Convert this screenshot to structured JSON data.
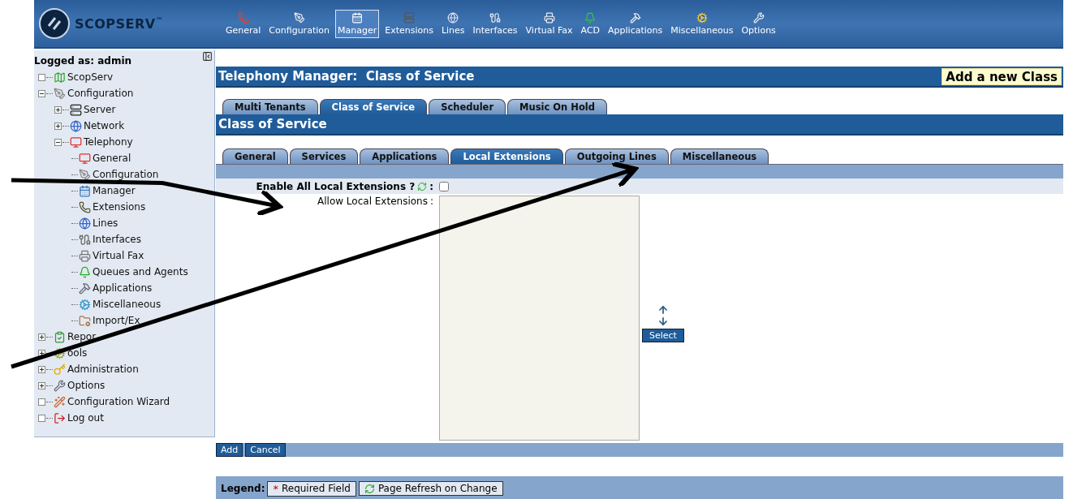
{
  "header": {
    "logo": "SCOPSERV",
    "logo_mark": "™"
  },
  "toolbar": [
    {
      "label": "General",
      "selected": false
    },
    {
      "label": "Configuration",
      "selected": false
    },
    {
      "label": "Manager",
      "selected": true
    },
    {
      "label": "Extensions",
      "selected": false
    },
    {
      "label": "Lines",
      "selected": false
    },
    {
      "label": "Interfaces",
      "selected": false
    },
    {
      "label": "Virtual Fax",
      "selected": false
    },
    {
      "label": "ACD",
      "selected": false
    },
    {
      "label": "Applications",
      "selected": false
    },
    {
      "label": "Miscellaneous",
      "selected": false
    },
    {
      "label": "Options",
      "selected": false
    }
  ],
  "sidebar": {
    "user_label": "Logged as: admin",
    "tree": [
      {
        "label": "ScopServ"
      },
      {
        "label": "Configuration",
        "expanded": true,
        "children": [
          {
            "label": "Server",
            "expanded": false
          },
          {
            "label": "Network",
            "expanded": false
          },
          {
            "label": "Telephony",
            "expanded": true,
            "children": [
              {
                "label": "General"
              },
              {
                "label": "Configuration"
              },
              {
                "label": "Manager"
              },
              {
                "label": "Extensions"
              },
              {
                "label": "Lines"
              },
              {
                "label": "Interfaces"
              },
              {
                "label": "Virtual Fax"
              },
              {
                "label": "Queues and Agents"
              },
              {
                "label": "Applications"
              },
              {
                "label": "Miscellaneous"
              },
              {
                "label": "Import/Ex"
              }
            ]
          }
        ]
      },
      {
        "label": "Repor",
        "expanded": false
      },
      {
        "label": "ools",
        "expanded": false
      },
      {
        "label": "Administration",
        "expanded": false
      },
      {
        "label": "Options",
        "expanded": false
      },
      {
        "label": "Configuration Wizard"
      },
      {
        "label": "Log out"
      }
    ]
  },
  "main": {
    "title": "Telephony Manager:  Class of Service",
    "add_button": "Add a new Class",
    "tabs": [
      {
        "label": "Multi Tenants",
        "selected": false
      },
      {
        "label": "Class of Service",
        "selected": true
      },
      {
        "label": "Scheduler",
        "selected": false
      },
      {
        "label": "Music On Hold",
        "selected": false
      }
    ],
    "section_title": "Class of Service",
    "subtabs": [
      {
        "label": "General",
        "selected": false
      },
      {
        "label": "Services",
        "selected": false
      },
      {
        "label": "Applications",
        "selected": false
      },
      {
        "label": "Local Extensions",
        "selected": true
      },
      {
        "label": "Outgoing Lines",
        "selected": false
      },
      {
        "label": "Miscellaneous",
        "selected": false
      }
    ],
    "form": {
      "enable_label": "Enable All Local Extensions ?",
      "enable_colon": ":",
      "enable_checked": false,
      "allow_label": "Allow Local Extensions",
      "allow_colon": ":",
      "select_button": "Select"
    },
    "actions": [
      "Add",
      "Cancel"
    ],
    "legend": {
      "label": "Legend:",
      "items": [
        {
          "kind": "required",
          "mark": "*",
          "text": "Required Field"
        },
        {
          "kind": "refresh",
          "text": "Page Refresh on Change"
        }
      ]
    }
  }
}
